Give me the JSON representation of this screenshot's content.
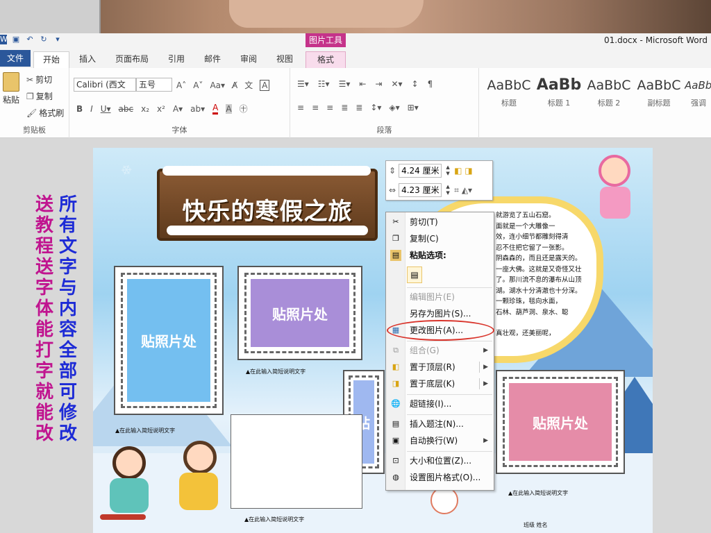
{
  "window": {
    "title": "01.docx - Microsoft Word",
    "context_tab_header": "图片工具"
  },
  "tabs": [
    {
      "label": "文件"
    },
    {
      "label": "开始"
    },
    {
      "label": "插入"
    },
    {
      "label": "页面布局"
    },
    {
      "label": "引用"
    },
    {
      "label": "邮件"
    },
    {
      "label": "审阅"
    },
    {
      "label": "视图"
    },
    {
      "label": "格式"
    }
  ],
  "ribbon": {
    "clipboard": {
      "paste": "粘贴",
      "cut": "剪切",
      "copy": "复制",
      "format_painter": "格式刷",
      "label": "剪贴板"
    },
    "font": {
      "font_name": "Calibri (西文",
      "font_size": "五号",
      "label": "字体"
    },
    "paragraph": {
      "label": "段落"
    },
    "styles": [
      {
        "sample": "AaBbC",
        "name": "标题"
      },
      {
        "sample": "AaBb",
        "name": "标题 1"
      },
      {
        "sample": "AaBbC",
        "name": "标题 2"
      },
      {
        "sample": "AaBbC",
        "name": "副标题"
      },
      {
        "sample": "AaBbC",
        "name": "强调"
      }
    ]
  },
  "promo": {
    "col1": "送教程 送字体 能打字就能改",
    "col2": "所有文字与内容全部可修改"
  },
  "document": {
    "title": "快乐的寒假之旅",
    "photo_placeholder": "贴照片处",
    "photo_placeholder_short": "贴",
    "caption": "▲在此输入简短说明文字",
    "name_label": "班级     姓名",
    "cloud_lines": [
      "就游览了五山石窟。",
      "面就是一个大雕像一",
      "效，连小细节都雕刻得清",
      "忍不住把它留了一张影。",
      "阴森森的，而且还是露天的。",
      "一座大佛。这就是又奇怪又壮",
      "了。那川流不息的瀑布从山顶",
      "湖。湖水十分清澈也十分深。",
      "一颗珍珠，毯向水面，",
      "石林、葫芦洞、泉水、聪",
      "",
      "真壮观，还美丽呢，"
    ]
  },
  "size_toolbar": {
    "height": "4.24 厘米",
    "width": "4.23 厘米"
  },
  "context_menu": {
    "items": [
      {
        "label": "剪切(T)",
        "icon": "scissors-icon",
        "enabled": true
      },
      {
        "label": "复制(C)",
        "icon": "copy-icon",
        "enabled": true
      },
      {
        "label": "粘贴选项:",
        "icon": "paste-icon",
        "enabled": true
      },
      {
        "label": "编辑图片(E)",
        "icon": "",
        "enabled": false
      },
      {
        "label": "另存为图片(S)...",
        "icon": "",
        "enabled": true
      },
      {
        "label": "更改图片(A)...",
        "icon": "change-picture-icon",
        "enabled": true
      },
      {
        "label": "组合(G)",
        "icon": "group-icon",
        "enabled": false
      },
      {
        "label": "置于顶层(R)",
        "icon": "bring-front-icon",
        "enabled": true
      },
      {
        "label": "置于底层(K)",
        "icon": "send-back-icon",
        "enabled": true
      },
      {
        "label": "超链接(I)...",
        "icon": "hyperlink-icon",
        "enabled": true
      },
      {
        "label": "插入题注(N)...",
        "icon": "caption-icon",
        "enabled": true
      },
      {
        "label": "自动换行(W)",
        "icon": "wrap-icon",
        "enabled": true
      },
      {
        "label": "大小和位置(Z)...",
        "icon": "size-icon",
        "enabled": true
      },
      {
        "label": "设置图片格式(O)...",
        "icon": "format-picture-icon",
        "enabled": true
      }
    ]
  },
  "colors": {
    "file_tab": "#2b579a",
    "context_tab": "#c5338a",
    "highlight_oval": "#d9342b",
    "photo_blue": "#74bff0",
    "photo_purple": "#a98ed8",
    "photo_pink": "#e58ca8"
  }
}
